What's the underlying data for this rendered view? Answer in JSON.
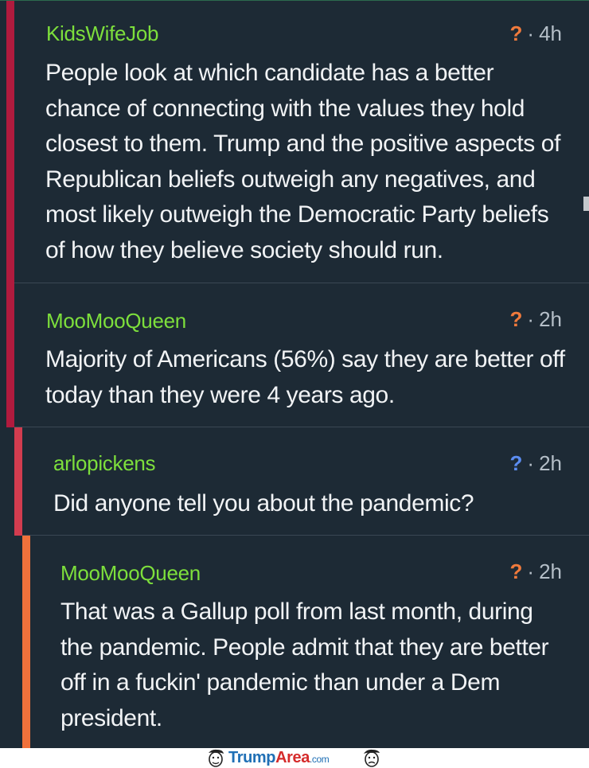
{
  "comments": [
    {
      "username": "KidsWifeJob",
      "time": "4h",
      "bar_color": "#b01b3e",
      "q_color": "#f07a3c",
      "body": "People look at which candidate has a better chance of connecting with the values they hold closest to them. Trump and the positive aspects of Republican beliefs outweigh any negatives, and most likely outweigh the Democratic Party beliefs of how they believe society should run."
    },
    {
      "username": "MooMooQueen",
      "time": "2h",
      "bar_color": "#b01b3e",
      "q_color": "#f07a3c",
      "body": "Majority of Americans (56%) say they are better off today than they were 4 years ago."
    },
    {
      "username": "arlopickens",
      "time": "2h",
      "bar_color": "#d23c4f",
      "q_color": "#5b8cf0",
      "body": "Did anyone tell you about the pandemic?"
    },
    {
      "username": "MooMooQueen",
      "time": "2h",
      "bar_color": "#f0713b",
      "q_color": "#f07a3c",
      "body": "That was a Gallup poll from last month, during the pandemic. People admit that they are better off in a fuckin' pandemic than under a Dem president."
    }
  ],
  "meta_symbols": {
    "question": "?",
    "dot": "·"
  },
  "footer": {
    "brand_trump": "Trump",
    "brand_area": "Area",
    "brand_com": ".com"
  },
  "colors": {
    "background": "#1d2a35",
    "username": "#7ddf3c",
    "text": "#f1f3f5"
  }
}
